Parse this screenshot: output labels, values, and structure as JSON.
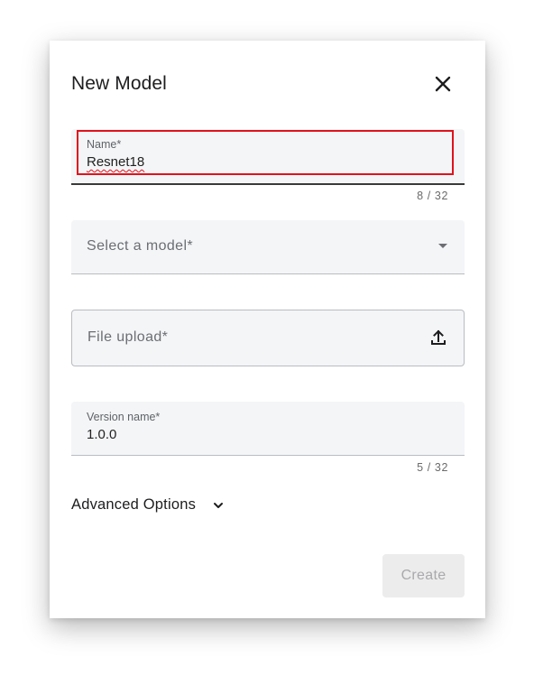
{
  "dialog": {
    "title": "New Model",
    "close_icon": "close-icon"
  },
  "name_field": {
    "label": "Name*",
    "value": "Resnet18",
    "counter": "8 / 32"
  },
  "model_select": {
    "placeholder": "Select a model*",
    "icon": "dropdown-arrow-icon"
  },
  "file_upload": {
    "placeholder": "File upload*",
    "icon": "upload-icon"
  },
  "version_field": {
    "label": "Version name*",
    "value": "1.0.0",
    "counter": "5 / 32"
  },
  "advanced_options": {
    "label": "Advanced Options",
    "icon": "chevron-down-icon"
  },
  "actions": {
    "create_label": "Create"
  },
  "colors": {
    "focus_outline": "#e0121c",
    "field_background": "#f4f5f7",
    "disabled_button": "#ececed"
  }
}
